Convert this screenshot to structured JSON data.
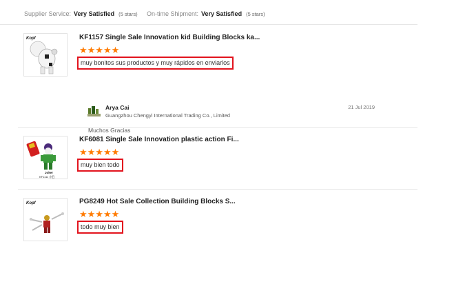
{
  "ratings": {
    "supplier_label": "Supplier Service:",
    "supplier_value": "Very Satisfied",
    "supplier_stars": "(5 stars)",
    "ontime_label": "On-time Shipment:",
    "ontime_value": "Very Satisfied",
    "ontime_stars": "(5 stars)"
  },
  "reviews": [
    {
      "title": "KF1157 Single Sale Innovation kid Building Blocks ka...",
      "stars": "★★★★★",
      "rating": 5,
      "comment": "muy bonitos sus productos y muy rápidos en enviarlos",
      "thumb_logo": "Kopf",
      "reply": {
        "name": "Arya Cai",
        "company": "Guangzhou Chengyi International Trading Co., Limited",
        "date": "21 Jul 2019",
        "message": "Muchos Gracias"
      }
    },
    {
      "title": "KF6081 Single Sale Innovation plastic action Fi...",
      "stars": "★★★★★",
      "rating": 5,
      "comment": "muy bien todo",
      "thumb_caption": "Joker",
      "thumb_code": "KF1111 小丑"
    },
    {
      "title": "PG8249 Hot Sale Collection Building Blocks S...",
      "stars": "★★★★★",
      "rating": 5,
      "comment": "todo muy bien",
      "thumb_logo": "Kopf"
    }
  ],
  "colors": {
    "star": "#ff7a00",
    "highlight_box": "#e2131d"
  },
  "icons": {
    "rating_star": "star-icon",
    "seller_avatar": "seller-avatar-icon"
  }
}
